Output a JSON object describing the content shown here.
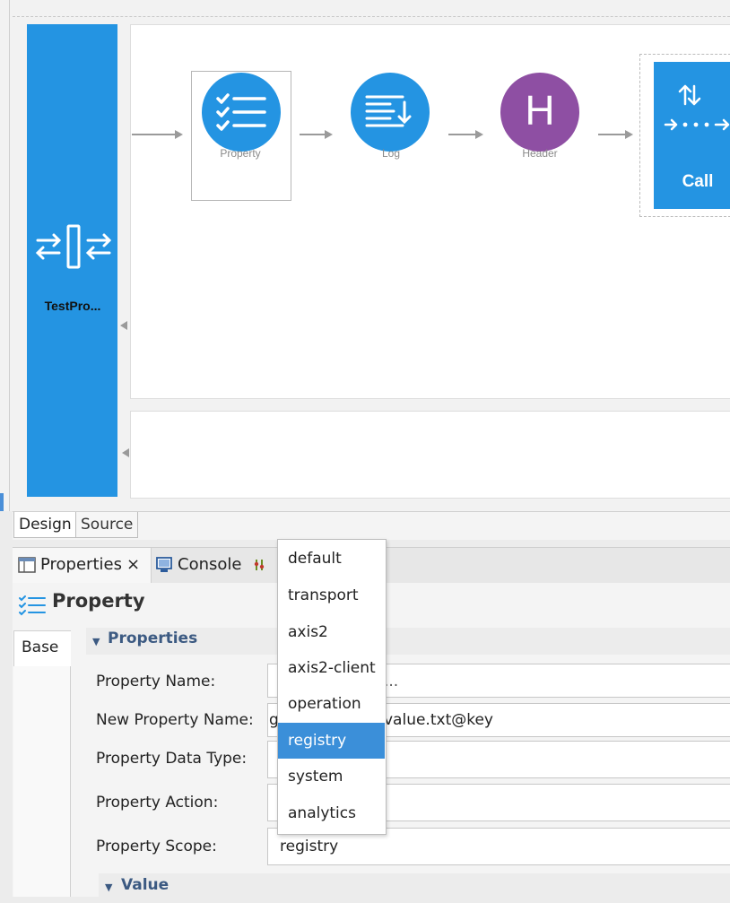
{
  "canvas": {
    "proxy_label": "TestPro...",
    "mediators": [
      {
        "name": "Property",
        "letter": ""
      },
      {
        "name": "Log",
        "letter": ""
      },
      {
        "name": "Header",
        "letter": "H"
      }
    ],
    "call_label": "Call"
  },
  "editor_tabs": [
    "Design",
    "Source"
  ],
  "view_tabs": {
    "properties": "Properties",
    "close": "×",
    "console": "Console"
  },
  "panel": {
    "title": "Property",
    "base_tab": "Base",
    "section": "Properties",
    "value_section": "Value",
    "fields": [
      {
        "label": "Property Name:",
        "value": "..."
      },
      {
        "label": "New Property Name:",
        "value_prefix": "g",
        "value": "value.txt@key"
      },
      {
        "label": "Property Data Type:",
        "value": ""
      },
      {
        "label": "Property Action:",
        "value": ""
      },
      {
        "label": "Property Scope:",
        "value": "registry"
      }
    ]
  },
  "dropdown": {
    "options": [
      "default",
      "transport",
      "axis2",
      "axis2-client",
      "operation",
      "registry",
      "system",
      "analytics"
    ],
    "selected": "registry"
  },
  "colors": {
    "accent_blue": "#2494e2",
    "header_purple": "#8e4fa3",
    "selection_blue": "#3b8fd9",
    "section_title": "#3c5a82"
  }
}
